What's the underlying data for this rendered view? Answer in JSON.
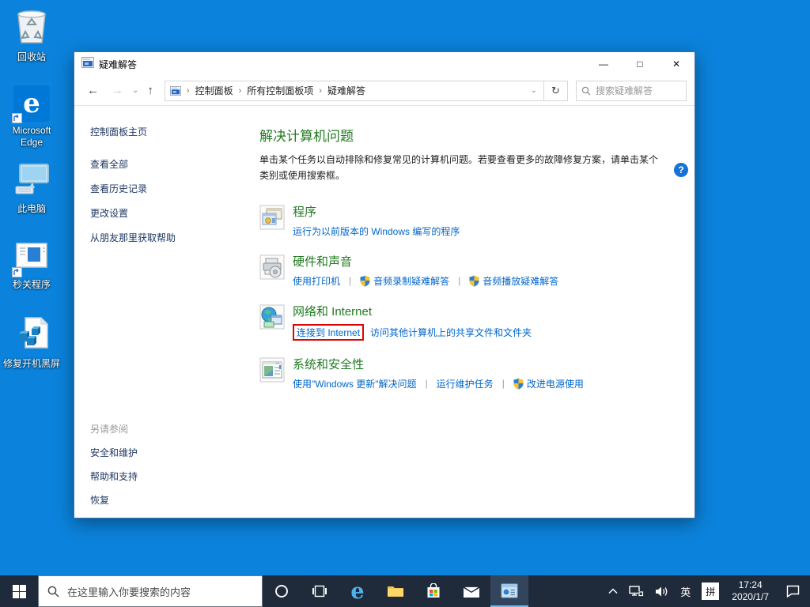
{
  "glyphs": {
    "pipe": "|",
    "back": "←",
    "forward": "→",
    "up": "↑",
    "chevron_down": "⌄",
    "chevron_right": "›",
    "refresh": "↻",
    "minimize": "—",
    "maximize": "□",
    "close": "✕",
    "help": "?"
  },
  "desktop": {
    "icons": [
      {
        "label": "回收站"
      },
      {
        "label": "Microsoft Edge"
      },
      {
        "label": "此电脑"
      },
      {
        "label": "秒关程序"
      },
      {
        "label": "修复开机黑屏"
      }
    ],
    "edge_letter": "e"
  },
  "window": {
    "title": "疑难解答",
    "breadcrumb": {
      "items": [
        "控制面板",
        "所有控制面板项",
        "疑难解答"
      ]
    },
    "search_placeholder": "搜索疑难解答",
    "sidebar": {
      "home": "控制面板主页",
      "tasks": [
        "查看全部",
        "查看历史记录",
        "更改设置",
        "从朋友那里获取帮助"
      ],
      "see_also_header": "另请参阅",
      "see_also_links": [
        "安全和维护",
        "帮助和支持",
        "恢复"
      ]
    },
    "main": {
      "title": "解决计算机问题",
      "description": "单击某个任务以自动排除和修复常见的计算机问题。若要查看更多的故障修复方案，请单击某个类别或使用搜索框。",
      "sections": [
        {
          "title": "程序",
          "links": [
            {
              "label": "运行为以前版本的 Windows 编写的程序"
            }
          ]
        },
        {
          "title": "硬件和声音",
          "links": [
            {
              "label": "使用打印机"
            },
            {
              "label": "音频录制疑难解答"
            },
            {
              "label": "音频播放疑难解答"
            }
          ]
        },
        {
          "title": "网络和 Internet",
          "links": [
            {
              "label": "连接到 Internet"
            },
            {
              "label": "访问其他计算机上的共享文件和文件夹"
            }
          ]
        },
        {
          "title": "系统和安全性",
          "links": [
            {
              "label": "使用\"Windows 更新\"解决问题"
            },
            {
              "label": "运行维护任务"
            },
            {
              "label": "改进电源使用"
            }
          ]
        }
      ]
    }
  },
  "taskbar": {
    "search_placeholder": "在这里输入你要搜索的内容",
    "tray": {
      "language": "英",
      "ime": "拼",
      "time": "17:24",
      "date": "2020/1/7"
    }
  },
  "colors": {
    "desktop_blue": "#0b83dc",
    "taskbar_dark": "#1f2b3a",
    "heading_green": "#217a21",
    "link_blue": "#0066cc",
    "highlight_red": "#dd0404",
    "accent_active": "#76b9ed"
  }
}
